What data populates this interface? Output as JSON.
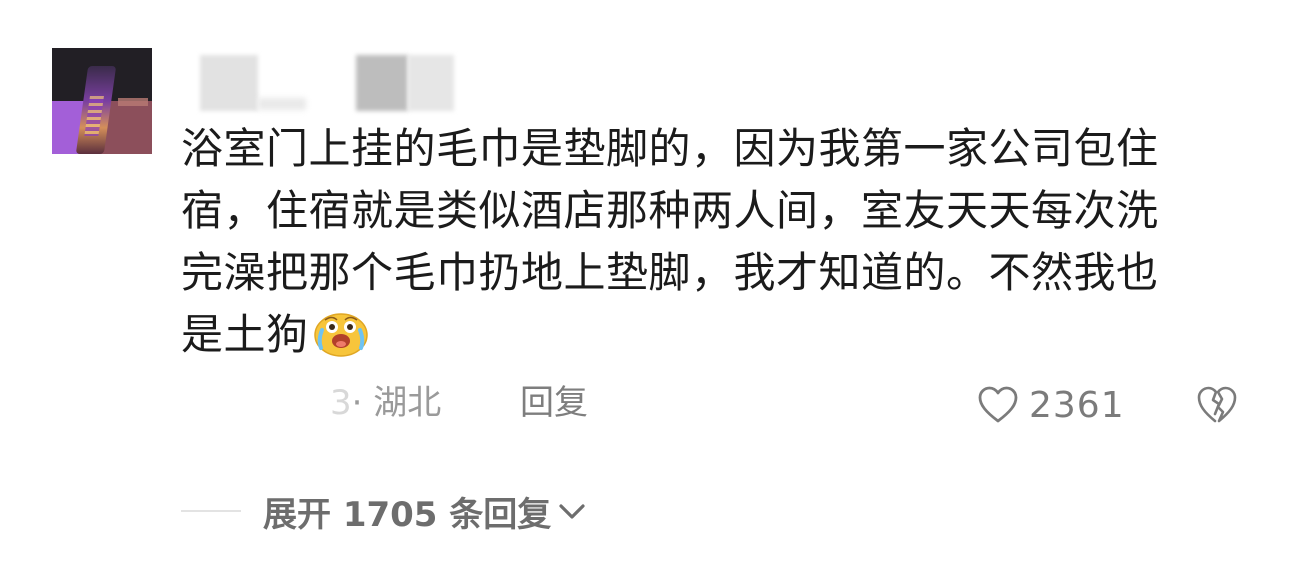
{
  "comment": {
    "body_lines": [
      "浴室门上挂的毛巾是垫脚的，因为我第一家公司包住",
      "宿，住宿就是类似酒店那种两人间，室友天天每次洗",
      "完澡把那个毛巾扔地上垫脚，我才知道的。不然我也",
      "是土狗"
    ],
    "emoji": "laughing-crying-emoji",
    "time_partial": "3",
    "separator": "·",
    "location": "湖北",
    "reply_label": "回复",
    "like_count": "2361",
    "expand_label": "展开 1705 条回复"
  },
  "colors": {
    "text": "#1b1b1b",
    "meta": "#8e8e8e",
    "like_icon": "#7b7b7b",
    "emoji_face": "#f7c53b"
  }
}
